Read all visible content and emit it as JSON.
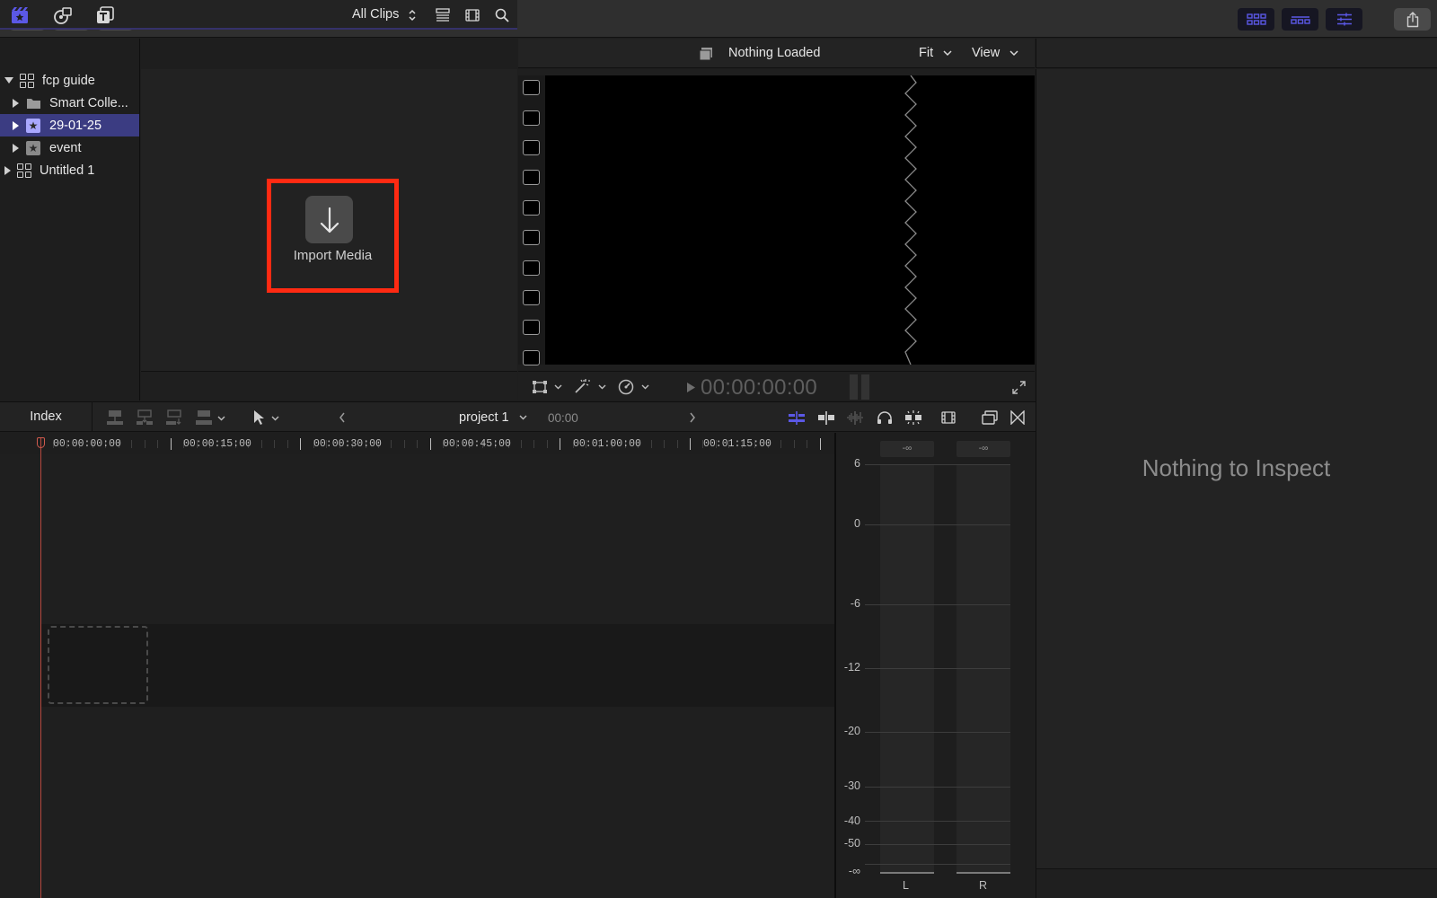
{
  "toolbar": {
    "buttons": [
      {
        "name": "import-icon"
      },
      {
        "name": "keyword-icon"
      },
      {
        "name": "background-tasks-icon"
      }
    ],
    "workspace_buttons": [
      "browser-toggle-icon",
      "timeline-toggle-icon",
      "inspector-toggle-icon"
    ],
    "accent": "#5b58e6",
    "share_icon": "share-icon"
  },
  "browser": {
    "tabs": [
      "libraries-icon",
      "photos-audio-icon",
      "titles-generators-icon"
    ],
    "filter_label": "All Clips",
    "library": [
      {
        "label": "fcp guide",
        "type": "library",
        "expanded": true,
        "selected": false
      },
      {
        "label": "Smart Colle...",
        "type": "folder",
        "expanded": false,
        "selected": false
      },
      {
        "label": "29-01-25",
        "type": "event",
        "expanded": false,
        "selected": true
      },
      {
        "label": "event",
        "type": "event",
        "expanded": false,
        "selected": false
      },
      {
        "label": "Untitled 1",
        "type": "library",
        "expanded": false,
        "selected": false
      }
    ],
    "import_label": "Import Media",
    "highlight_color": "#ff2a12"
  },
  "viewer": {
    "title": "Nothing Loaded",
    "fit_label": "Fit",
    "view_label": "View",
    "timecode": "00:00:00:00"
  },
  "inspector": {
    "message": "Nothing to Inspect"
  },
  "timeline": {
    "index_label": "Index",
    "project_name": "project 1",
    "duration": "00:00",
    "ruler_labels": [
      "00:00:00:00",
      "00:00:15:00",
      "00:00:30:00",
      "00:00:45:00",
      "00:01:00:00",
      "00:01:15:00"
    ]
  },
  "audio_meters": {
    "peak_left": "-∞",
    "peak_right": "-∞",
    "scale": [
      "6",
      "0",
      "-6",
      "-12",
      "-20",
      "-30",
      "-40",
      "-50",
      "-∞"
    ],
    "channels": [
      "L",
      "R"
    ]
  }
}
